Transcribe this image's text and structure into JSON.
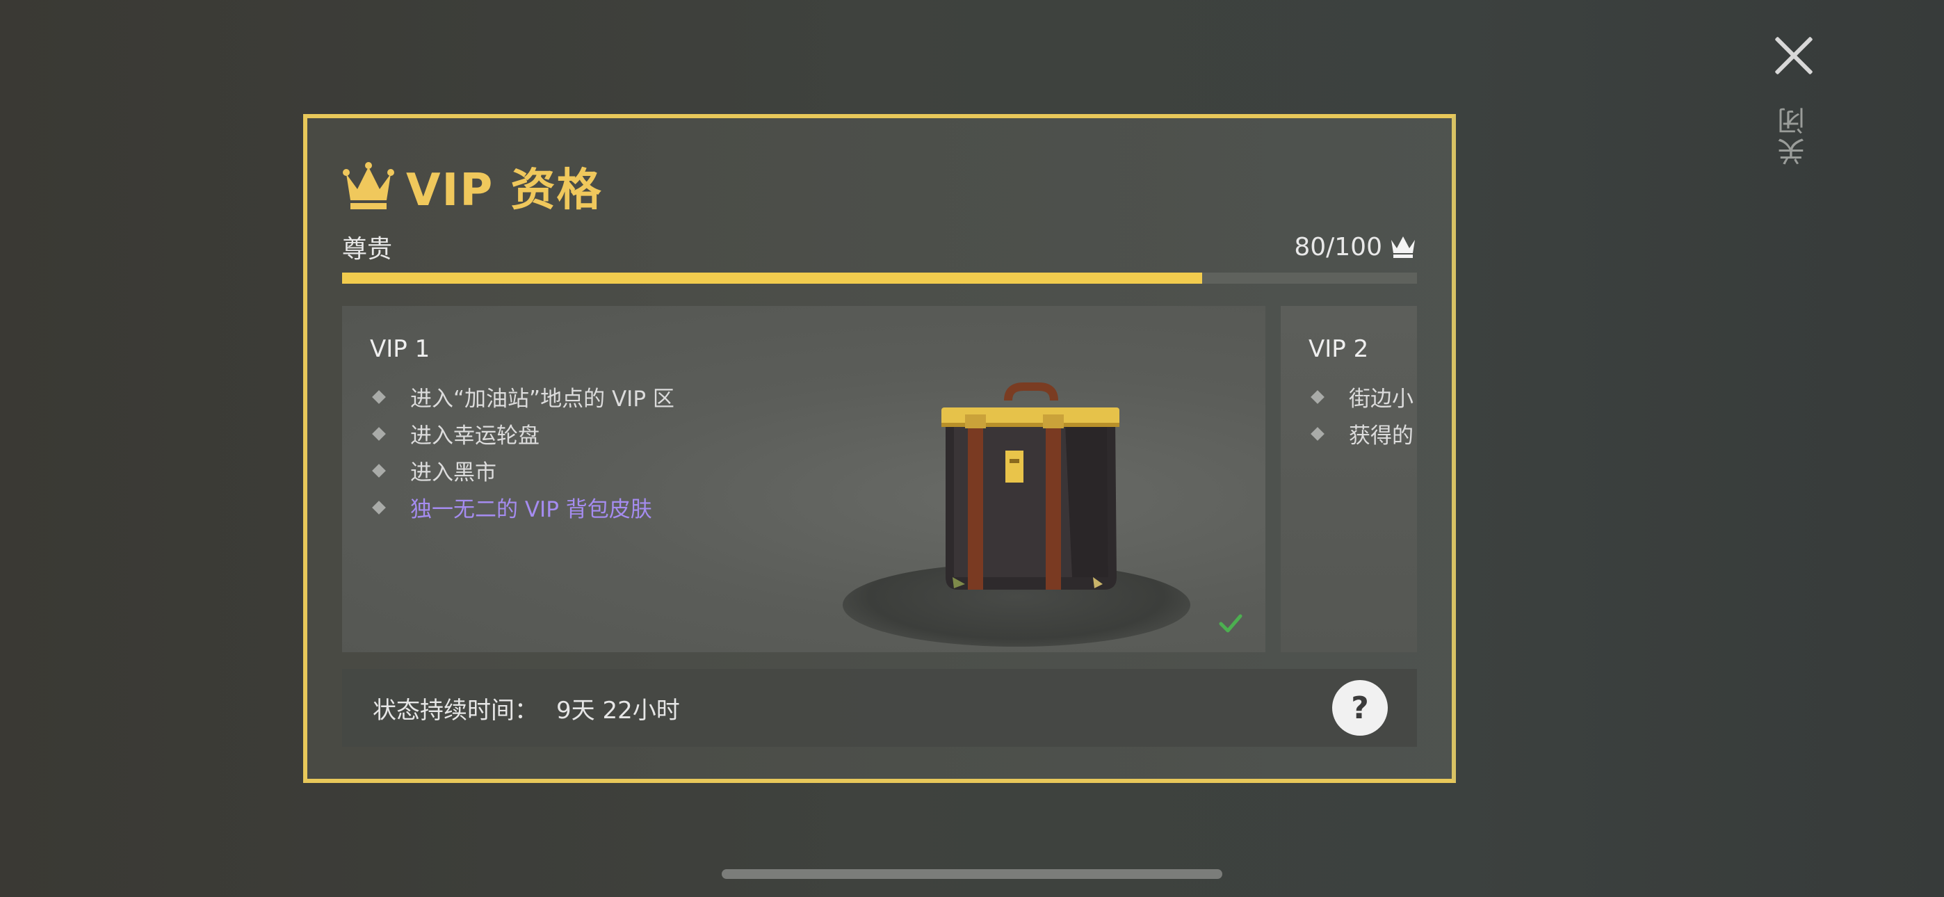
{
  "close": {
    "label": "关闭",
    "icon": "close-icon"
  },
  "header": {
    "title": "VIP 资格",
    "rank": "尊贵",
    "score": "80/100"
  },
  "progress": {
    "value": 80,
    "max": 100,
    "fraction": 0.8
  },
  "tiers": [
    {
      "name": "VIP 1",
      "benefits": [
        {
          "text": "进入“加油站”地点的 VIP 区",
          "special": false
        },
        {
          "text": "进入幸运轮盘",
          "special": false
        },
        {
          "text": "进入黑市",
          "special": false
        },
        {
          "text": "独一无二的 VIP 背包皮肤",
          "special": true
        }
      ],
      "unlocked": true
    },
    {
      "name": "VIP 2",
      "benefits": [
        {
          "text": "街边小",
          "special": false
        },
        {
          "text": "获得的",
          "special": false
        }
      ]
    }
  ],
  "status": {
    "label": "状态持续时间：",
    "value": "9天 22小时",
    "help": "?"
  },
  "colors": {
    "gold": "#f0c85c",
    "special": "#a58cf0",
    "check": "#4caf50"
  }
}
